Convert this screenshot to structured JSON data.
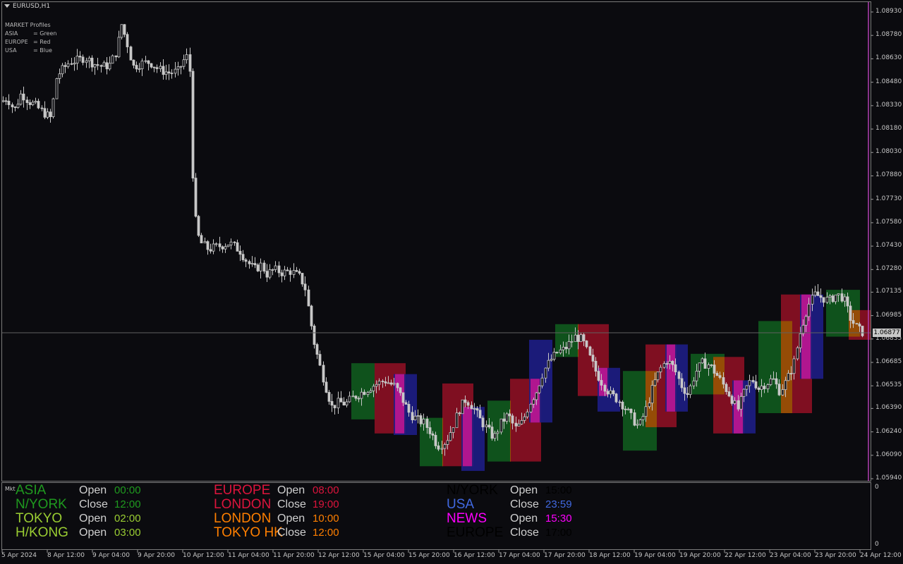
{
  "header": {
    "symbol": "EURUSD,H1",
    "arrow_icon": "triangle-down-icon"
  },
  "legend": {
    "title": "MARKET Profiles",
    "rows": [
      {
        "name": "ASIA",
        "value": "= Green"
      },
      {
        "name": "EUROPE",
        "value": "= Red"
      },
      {
        "name": "USA",
        "value": "= Blue"
      }
    ]
  },
  "price_axis": {
    "labels": [
      "1.08930",
      "1.08780",
      "1.08630",
      "1.08480",
      "1.08330",
      "1.08180",
      "1.08030",
      "1.07880",
      "1.07730",
      "1.07580",
      "1.07430",
      "1.07280",
      "1.07135",
      "1.06985",
      "1.06835",
      "1.06685",
      "1.06535",
      "1.06390",
      "1.06240",
      "1.06090",
      "1.05940"
    ],
    "current_price": "1.06877"
  },
  "time_axis": {
    "labels": [
      "5 Apr 2024",
      "8 Apr 12:00",
      "9 Apr 04:00",
      "9 Apr 20:00",
      "10 Apr 12:00",
      "11 Apr 04:00",
      "11 Apr 20:00",
      "12 Apr 12:00",
      "15 Apr 04:00",
      "15 Apr 20:00",
      "16 Apr 12:00",
      "17 Apr 04:00",
      "17 Apr 20:00",
      "18 Apr 12:00",
      "19 Apr 04:00",
      "19 Apr 20:00",
      "22 Apr 12:00",
      "23 Apr 04:00",
      "23 Apr 20:00",
      "24 Apr 12:00"
    ]
  },
  "indicator_panel": {
    "label": "Mkt",
    "scale_top": "0",
    "scale_bottom": "0",
    "sessions": [
      {
        "name": "ASIA",
        "action": "Open",
        "time": "00:00",
        "color": "#1f9a1f"
      },
      {
        "name": "N/YORK",
        "action": "Close",
        "time": "12:00",
        "color": "#1f9a1f"
      },
      {
        "name": "TOKYO",
        "action": "Open",
        "time": "02:00",
        "color": "#9acd32"
      },
      {
        "name": "H/KONG",
        "action": "Open",
        "time": "03:00",
        "color": "#9acd32"
      },
      {
        "name": "EUROPE",
        "action": "Open",
        "time": "08:00",
        "color": "#dc143c"
      },
      {
        "name": "LONDON",
        "action": "Close",
        "time": "19:00",
        "color": "#dc143c"
      },
      {
        "name": "LONDON",
        "action": "Open",
        "time": "10:00",
        "color": "#ff7f00"
      },
      {
        "name": "TOKYO HK",
        "action": "Close",
        "time": "12:00",
        "color": "#ff7f00"
      },
      {
        "name": "N/YORK",
        "action": "Open",
        "time": "15:00",
        "color": "#000000"
      },
      {
        "name": "USA",
        "action": "Close",
        "time": "23:59",
        "color": "#4169e1"
      },
      {
        "name": "NEWS",
        "action": "Open",
        "time": "15:30",
        "color": "#ff00ff"
      },
      {
        "name": "EUROPE",
        "action": "Close",
        "time": "17:00",
        "color": "#000000"
      }
    ]
  },
  "chart_data": {
    "type": "candlestick",
    "symbol": "EURUSD",
    "timeframe": "H1",
    "ylim": [
      1.0594,
      1.0893
    ],
    "grid": false,
    "colors": {
      "background": "#0b0b0f",
      "candles": "#c8c8c8",
      "asia": "#0f5a1e",
      "europe": "#8c0f23",
      "usa": "#1e1e8c",
      "news": "#dc1496",
      "london": "#9b5a00",
      "price_line": "#606060"
    },
    "close_path": [
      [
        0,
        1.0835
      ],
      [
        10,
        1.0838
      ],
      [
        20,
        1.083
      ],
      [
        30,
        1.0841
      ],
      [
        40,
        1.0836
      ],
      [
        50,
        1.0833
      ],
      [
        60,
        1.0829
      ],
      [
        72,
        1.0825
      ],
      [
        80,
        1.0852
      ],
      [
        88,
        1.0856
      ],
      [
        98,
        1.0861
      ],
      [
        110,
        1.0862
      ],
      [
        120,
        1.0864
      ],
      [
        132,
        1.086
      ],
      [
        145,
        1.0858
      ],
      [
        155,
        1.0859
      ],
      [
        165,
        1.0868
      ],
      [
        172,
        1.0885
      ],
      [
        180,
        1.0873
      ],
      [
        188,
        1.0858
      ],
      [
        200,
        1.086
      ],
      [
        212,
        1.0861
      ],
      [
        225,
        1.0856
      ],
      [
        240,
        1.0854
      ],
      [
        252,
        1.0855
      ],
      [
        260,
        1.0862
      ],
      [
        268,
        1.0866
      ],
      [
        272,
        1.0795
      ],
      [
        278,
        1.0752
      ],
      [
        285,
        1.0745
      ],
      [
        295,
        1.0741
      ],
      [
        310,
        1.0743
      ],
      [
        325,
        1.0745
      ],
      [
        340,
        1.074
      ],
      [
        350,
        1.0733
      ],
      [
        360,
        1.0728
      ],
      [
        370,
        1.0731
      ],
      [
        378,
        1.0725
      ],
      [
        388,
        1.0728
      ],
      [
        400,
        1.0726
      ],
      [
        412,
        1.0727
      ],
      [
        425,
        1.0723
      ],
      [
        432,
        1.0717
      ],
      [
        438,
        1.07
      ],
      [
        444,
        1.0683
      ],
      [
        452,
        1.0668
      ],
      [
        460,
        1.0655
      ],
      [
        470,
        1.064
      ],
      [
        480,
        1.0643
      ],
      [
        490,
        1.0642
      ],
      [
        500,
        1.0646
      ],
      [
        515,
        1.065
      ],
      [
        530,
        1.0654
      ],
      [
        545,
        1.0657
      ],
      [
        560,
        1.0653
      ],
      [
        570,
        1.0645
      ],
      [
        580,
        1.0636
      ],
      [
        590,
        1.0632
      ],
      [
        600,
        1.063
      ],
      [
        610,
        1.0624
      ],
      [
        620,
        1.0615
      ],
      [
        632,
        1.0618
      ],
      [
        640,
        1.0626
      ],
      [
        650,
        1.0638
      ],
      [
        660,
        1.0645
      ],
      [
        670,
        1.064
      ],
      [
        680,
        1.0632
      ],
      [
        690,
        1.0626
      ],
      [
        700,
        1.062
      ],
      [
        710,
        1.063
      ],
      [
        720,
        1.0635
      ],
      [
        730,
        1.0626
      ],
      [
        740,
        1.063
      ],
      [
        750,
        1.0642
      ],
      [
        760,
        1.065
      ],
      [
        770,
        1.0663
      ],
      [
        780,
        1.067
      ],
      [
        790,
        1.0675
      ],
      [
        800,
        1.0677
      ],
      [
        815,
        1.0685
      ],
      [
        825,
        1.0683
      ],
      [
        835,
        1.0672
      ],
      [
        845,
        1.0662
      ],
      [
        855,
        1.0654
      ],
      [
        865,
        1.0648
      ],
      [
        875,
        1.0645
      ],
      [
        885,
        1.064
      ],
      [
        895,
        1.0633
      ],
      [
        905,
        1.0627
      ],
      [
        915,
        1.0638
      ],
      [
        925,
        1.0653
      ],
      [
        935,
        1.0664
      ],
      [
        945,
        1.067
      ],
      [
        955,
        1.0665
      ],
      [
        965,
        1.0654
      ],
      [
        975,
        1.0648
      ],
      [
        985,
        1.0662
      ],
      [
        995,
        1.0668
      ],
      [
        1005,
        1.0667
      ],
      [
        1015,
        1.0661
      ],
      [
        1025,
        1.0654
      ],
      [
        1035,
        1.0647
      ],
      [
        1045,
        1.0638
      ],
      [
        1055,
        1.065
      ],
      [
        1065,
        1.0658
      ],
      [
        1075,
        1.0652
      ],
      [
        1085,
        1.0655
      ],
      [
        1095,
        1.0658
      ],
      [
        1105,
        1.065
      ],
      [
        1115,
        1.0657
      ],
      [
        1125,
        1.0668
      ],
      [
        1135,
        1.069
      ],
      [
        1145,
        1.0705
      ],
      [
        1155,
        1.0712
      ],
      [
        1165,
        1.071
      ],
      [
        1175,
        1.0708
      ],
      [
        1185,
        1.0712
      ],
      [
        1195,
        1.071
      ],
      [
        1205,
        1.0697
      ],
      [
        1215,
        1.069
      ],
      [
        1225,
        1.0687
      ]
    ],
    "session_boxes": [
      {
        "session": "asia",
        "t0": 498,
        "t1": 531,
        "high": 1.0668,
        "low": 1.0632
      },
      {
        "session": "europe",
        "t0": 531,
        "t1": 575,
        "high": 1.0668,
        "low": 1.0623
      },
      {
        "session": "usa",
        "t0": 558,
        "t1": 591,
        "high": 1.0661,
        "low": 1.0622
      },
      {
        "session": "asia",
        "t0": 595,
        "t1": 628,
        "high": 1.0633,
        "low": 1.0602
      },
      {
        "session": "europe",
        "t0": 627,
        "t1": 671,
        "high": 1.0655,
        "low": 1.0602
      },
      {
        "session": "usa",
        "t0": 654,
        "t1": 687,
        "high": 1.064,
        "low": 1.0599
      },
      {
        "session": "asia",
        "t0": 691,
        "t1": 724,
        "high": 1.0644,
        "low": 1.0605
      },
      {
        "session": "europe",
        "t0": 723,
        "t1": 767,
        "high": 1.0658,
        "low": 1.0605
      },
      {
        "session": "usa",
        "t0": 750,
        "t1": 783,
        "high": 1.0683,
        "low": 1.063
      },
      {
        "session": "asia",
        "t0": 787,
        "t1": 820,
        "high": 1.0693,
        "low": 1.0672
      },
      {
        "session": "europe",
        "t0": 819,
        "t1": 863,
        "high": 1.0693,
        "low": 1.0647
      },
      {
        "session": "usa",
        "t0": 847,
        "t1": 879,
        "high": 1.0665,
        "low": 1.0637
      },
      {
        "session": "asia",
        "t0": 883,
        "t1": 931,
        "high": 1.0663,
        "low": 1.0612
      },
      {
        "session": "europe",
        "t0": 915,
        "t1": 959,
        "high": 1.068,
        "low": 1.0627
      },
      {
        "session": "usa",
        "t0": 943,
        "t1": 975,
        "high": 1.068,
        "low": 1.0637
      },
      {
        "session": "asia",
        "t0": 979,
        "t1": 1027,
        "high": 1.0674,
        "low": 1.0648
      },
      {
        "session": "europe",
        "t0": 1011,
        "t1": 1055,
        "high": 1.0672,
        "low": 1.0623
      },
      {
        "session": "usa",
        "t0": 1038,
        "t1": 1071,
        "high": 1.0657,
        "low": 1.0623
      },
      {
        "session": "asia",
        "t0": 1075,
        "t1": 1123,
        "high": 1.0695,
        "low": 1.0636
      },
      {
        "session": "europe",
        "t0": 1107,
        "t1": 1151,
        "high": 1.0712,
        "low": 1.0636
      },
      {
        "session": "usa",
        "t0": 1134,
        "t1": 1167,
        "high": 1.0712,
        "low": 1.0658
      },
      {
        "session": "asia",
        "t0": 1171,
        "t1": 1219,
        "high": 1.0715,
        "low": 1.0685
      },
      {
        "session": "europe",
        "t0": 1203,
        "t1": 1234,
        "high": 1.0702,
        "low": 1.0683
      }
    ]
  }
}
